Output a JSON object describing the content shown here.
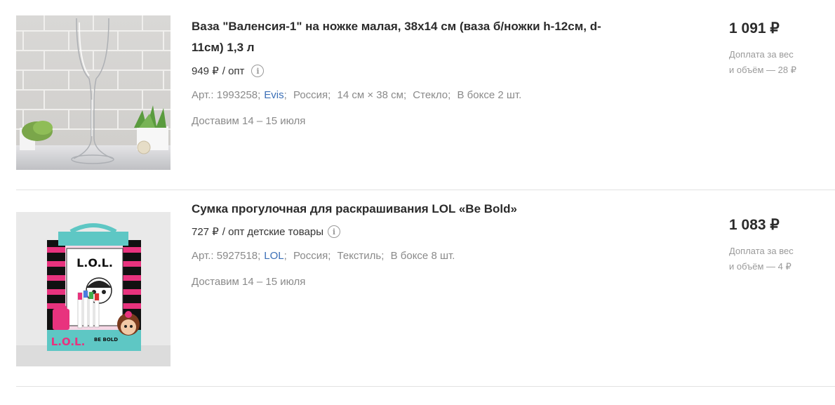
{
  "products": [
    {
      "title": "Ваза \"Валенсия-1\" на ножке малая, 38х14 см (ваза б/ножки h-12см, d-11см) 1,3 л",
      "title_line1": "Ваза \"Валенсия-1\" на ножке малая, 38х14 см (ваза б/ножки h-12см, d-",
      "title_line2": "11см) 1,3 л",
      "opt_price": "949 ₽",
      "opt_unit": "/ опт",
      "opt_extra": "",
      "article": "Арт.: 1993258;",
      "brand": "Evis",
      "country": "Россия;",
      "size": "14 см × 38 см;",
      "material": "Стекло;",
      "box": "В боксе 2 шт.",
      "delivery": "Доставим 14 – 15 июля",
      "price": "1 091 ₽",
      "surcharge_line1": "Доплата за вес",
      "surcharge_line2": "и объём — 28 ₽",
      "image_alt": "glass-vase-photo"
    },
    {
      "title_line1": "Сумка прогулочная для раскрашивания LOL «Be Bold»",
      "opt_price": "727 ₽",
      "opt_unit": "/ опт",
      "opt_extra": "детские товары",
      "article": "Арт.: 5927518;",
      "brand": "LOL",
      "country": "Россия;",
      "material": "Текстиль;",
      "box": "В боксе 8 шт.",
      "delivery": "Доставим 14 – 15 июля",
      "price": "1 083 ₽",
      "surcharge_line1": "Доплата за вес",
      "surcharge_line2": "и объём — 4 ₽",
      "image_alt": "lol-coloring-bag-photo",
      "packaging_text_main": "L.O.L.",
      "packaging_text_sub": "BE BOLD"
    }
  ],
  "info_icon_glyph": "i",
  "colors": {
    "link": "#3b6fb6",
    "muted": "#8a8a8a",
    "title": "#2b2b2b",
    "divider": "#e2e2e2",
    "lol_pink": "#e8337e",
    "lol_teal": "#5ec7c4"
  }
}
